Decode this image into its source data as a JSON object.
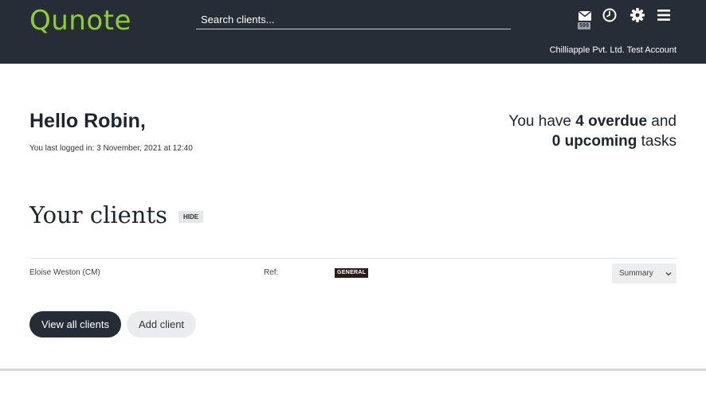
{
  "header": {
    "logo_text": "Qunote",
    "search_placeholder": "Search clients...",
    "mail_badge": "599",
    "account_name": "Chilliapple Pvt. Ltd. Test Account",
    "icons": [
      "mail-icon",
      "clock-icon",
      "gear-icon",
      "hamburger-menu-icon"
    ]
  },
  "welcome": {
    "greeting": "Hello Robin,",
    "last_login": "You last logged in: 3 November, 2021 at 12:40"
  },
  "tasks": {
    "line1_prefix": "You have ",
    "overdue": "4 overdue",
    "line1_suffix": " and",
    "upcoming": "0 upcoming",
    "line2_suffix": " tasks"
  },
  "clients": {
    "title": "Your clients",
    "hide_label": "HIDE",
    "rows": [
      {
        "name": "Eloise Weston (CM)",
        "ref_label": "Ref:",
        "tag": "GENERAL",
        "view": "Summary"
      }
    ],
    "view_all_label": "View all clients",
    "add_label": "Add client"
  },
  "colors": {
    "topbar": "#262d37",
    "logo": "#8fcf2a",
    "primary_button": "#252c36",
    "tag_bg": "#2a1c18"
  }
}
